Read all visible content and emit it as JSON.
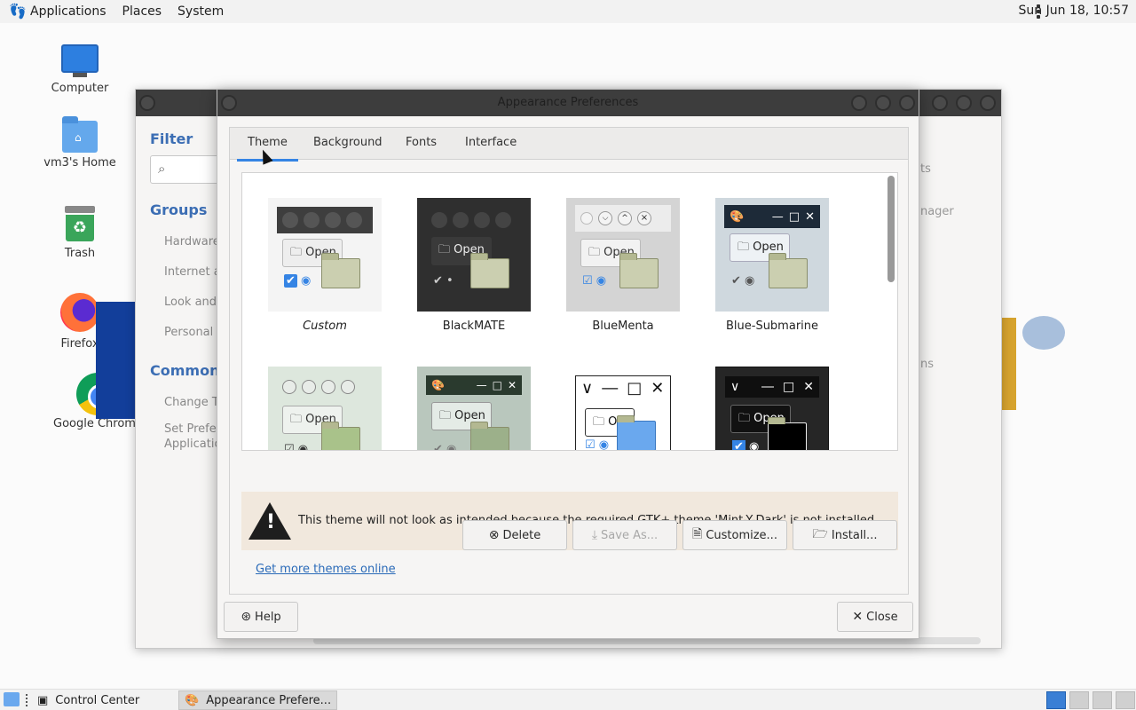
{
  "top_panel": {
    "menus": [
      "Applications",
      "Places",
      "System"
    ],
    "clock": "Sun Jun 18, 10:57"
  },
  "desktop_icons": [
    {
      "label": "Computer"
    },
    {
      "label": "vm3's Home"
    },
    {
      "label": "Trash"
    },
    {
      "label": "Firefox"
    },
    {
      "label": "Google Chrome"
    }
  ],
  "control_center": {
    "filter_label": "Filter",
    "groups_label": "Groups",
    "group_items": [
      "Hardware",
      "Internet a",
      "Look and",
      "Personal"
    ],
    "common_label": "Common T",
    "common_items": [
      "Change Th",
      "Set Prefer",
      "Applicatio"
    ],
    "right_fragments": [
      "ts",
      "anager",
      "ns"
    ]
  },
  "dialog": {
    "title": "Appearance Preferences",
    "tabs": [
      "Theme",
      "Background",
      "Fonts",
      "Interface"
    ],
    "active_tab": "Theme",
    "themes": [
      {
        "name": "Custom",
        "italic": true
      },
      {
        "name": "BlackMATE"
      },
      {
        "name": "BlueMenta"
      },
      {
        "name": "Blue-Submarine"
      }
    ],
    "thumb_open_label": "Open",
    "warning": "This theme will not look as intended because the required GTK+ theme 'Mint-Y-Dark' is not installed.",
    "buttons": {
      "delete": "Delete",
      "save_as": "Save As...",
      "customize": "Customize...",
      "install": "Install..."
    },
    "link": "Get more themes online",
    "help": "Help",
    "close": "Close"
  },
  "taskbar": {
    "items": [
      {
        "label": "Control Center"
      },
      {
        "label": "Appearance Prefere..."
      }
    ]
  },
  "colors": {
    "accent": "#3584e4",
    "titlebar": "#3d3d3d",
    "warning_bg": "#f1e8dd"
  }
}
